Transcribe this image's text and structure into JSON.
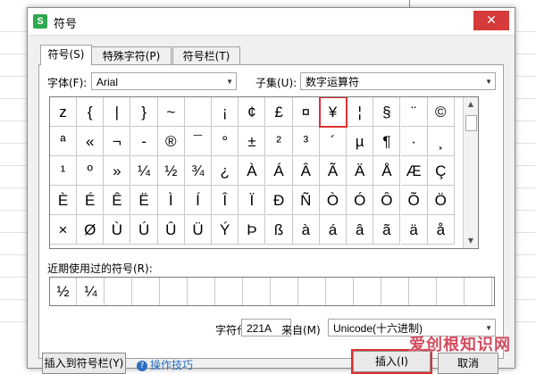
{
  "dialog": {
    "title": "符号",
    "app_icon": "S",
    "close": "✕"
  },
  "tabs": [
    "符号(S)",
    "特殊字符(P)",
    "符号栏(T)"
  ],
  "font": {
    "label": "字体(F):",
    "value": "Arial"
  },
  "subset": {
    "label": "子集(U):",
    "value": "数字运算符"
  },
  "symbols": [
    [
      "z",
      "{",
      "|",
      "}",
      "~",
      "",
      "¡",
      "¢",
      "£",
      "¤",
      "¥",
      "¦",
      "§",
      "¨",
      "©"
    ],
    [
      "ª",
      "«",
      "¬",
      "-",
      "®",
      "¯",
      "°",
      "±",
      "²",
      "³",
      "´",
      "µ",
      "¶",
      "·",
      "¸"
    ],
    [
      "¹",
      "º",
      "»",
      "¼",
      "½",
      "¾",
      "¿",
      "À",
      "Á",
      "Â",
      "Ã",
      "Ä",
      "Å",
      "Æ",
      "Ç"
    ],
    [
      "È",
      "É",
      "Ê",
      "Ë",
      "Ì",
      "Í",
      "Î",
      "Ï",
      "Ð",
      "Ñ",
      "Ò",
      "Ó",
      "Ô",
      "Õ",
      "Ö"
    ],
    [
      "×",
      "Ø",
      "Ù",
      "Ú",
      "Û",
      "Ü",
      "Ý",
      "Þ",
      "ß",
      "à",
      "á",
      "â",
      "ã",
      "ä",
      "å"
    ]
  ],
  "selected_symbol": {
    "row": 0,
    "col": 10
  },
  "recent": {
    "label": "近期使用过的符号(R):",
    "items": [
      "½",
      "¼",
      "",
      "",
      "",
      "",
      "",
      "",
      "",
      "",
      "",
      "",
      "",
      "",
      "",
      ""
    ]
  },
  "char_code": {
    "label": "字符代码(C):",
    "value": "221A"
  },
  "from": {
    "label": "来自(M)",
    "value": "Unicode(十六进制)"
  },
  "bottom": {
    "left_button": "插入到符号栏(Y)",
    "help": "操作技巧",
    "insert_button": "插入(I)",
    "cancel_button": "取消"
  },
  "watermark": "爱创根知识网",
  "colors": {
    "highlight": "#e03030",
    "accent": "#2fa84f"
  }
}
